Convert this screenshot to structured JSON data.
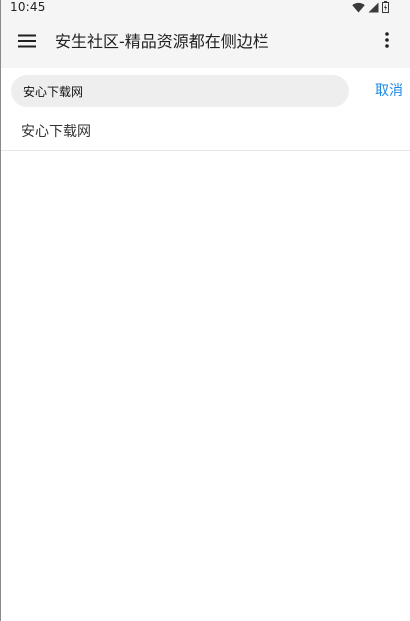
{
  "status_bar": {
    "time": "10:45",
    "icons": [
      "wifi-icon",
      "cellular-signal-icon",
      "battery-icon"
    ]
  },
  "app_bar": {
    "menu_icon": "hamburger-menu-icon",
    "title": "安生社区-精品资源都在侧边栏",
    "overflow_icon": "more-vertical-icon"
  },
  "search": {
    "value": "安心下载网",
    "cancel_label": "取消"
  },
  "suggestions": [
    {
      "label": "安心下载网"
    }
  ],
  "colors": {
    "accent": "#1e88e5",
    "app_bar_bg": "#f5f5f5",
    "search_bg": "#eeeeee"
  }
}
